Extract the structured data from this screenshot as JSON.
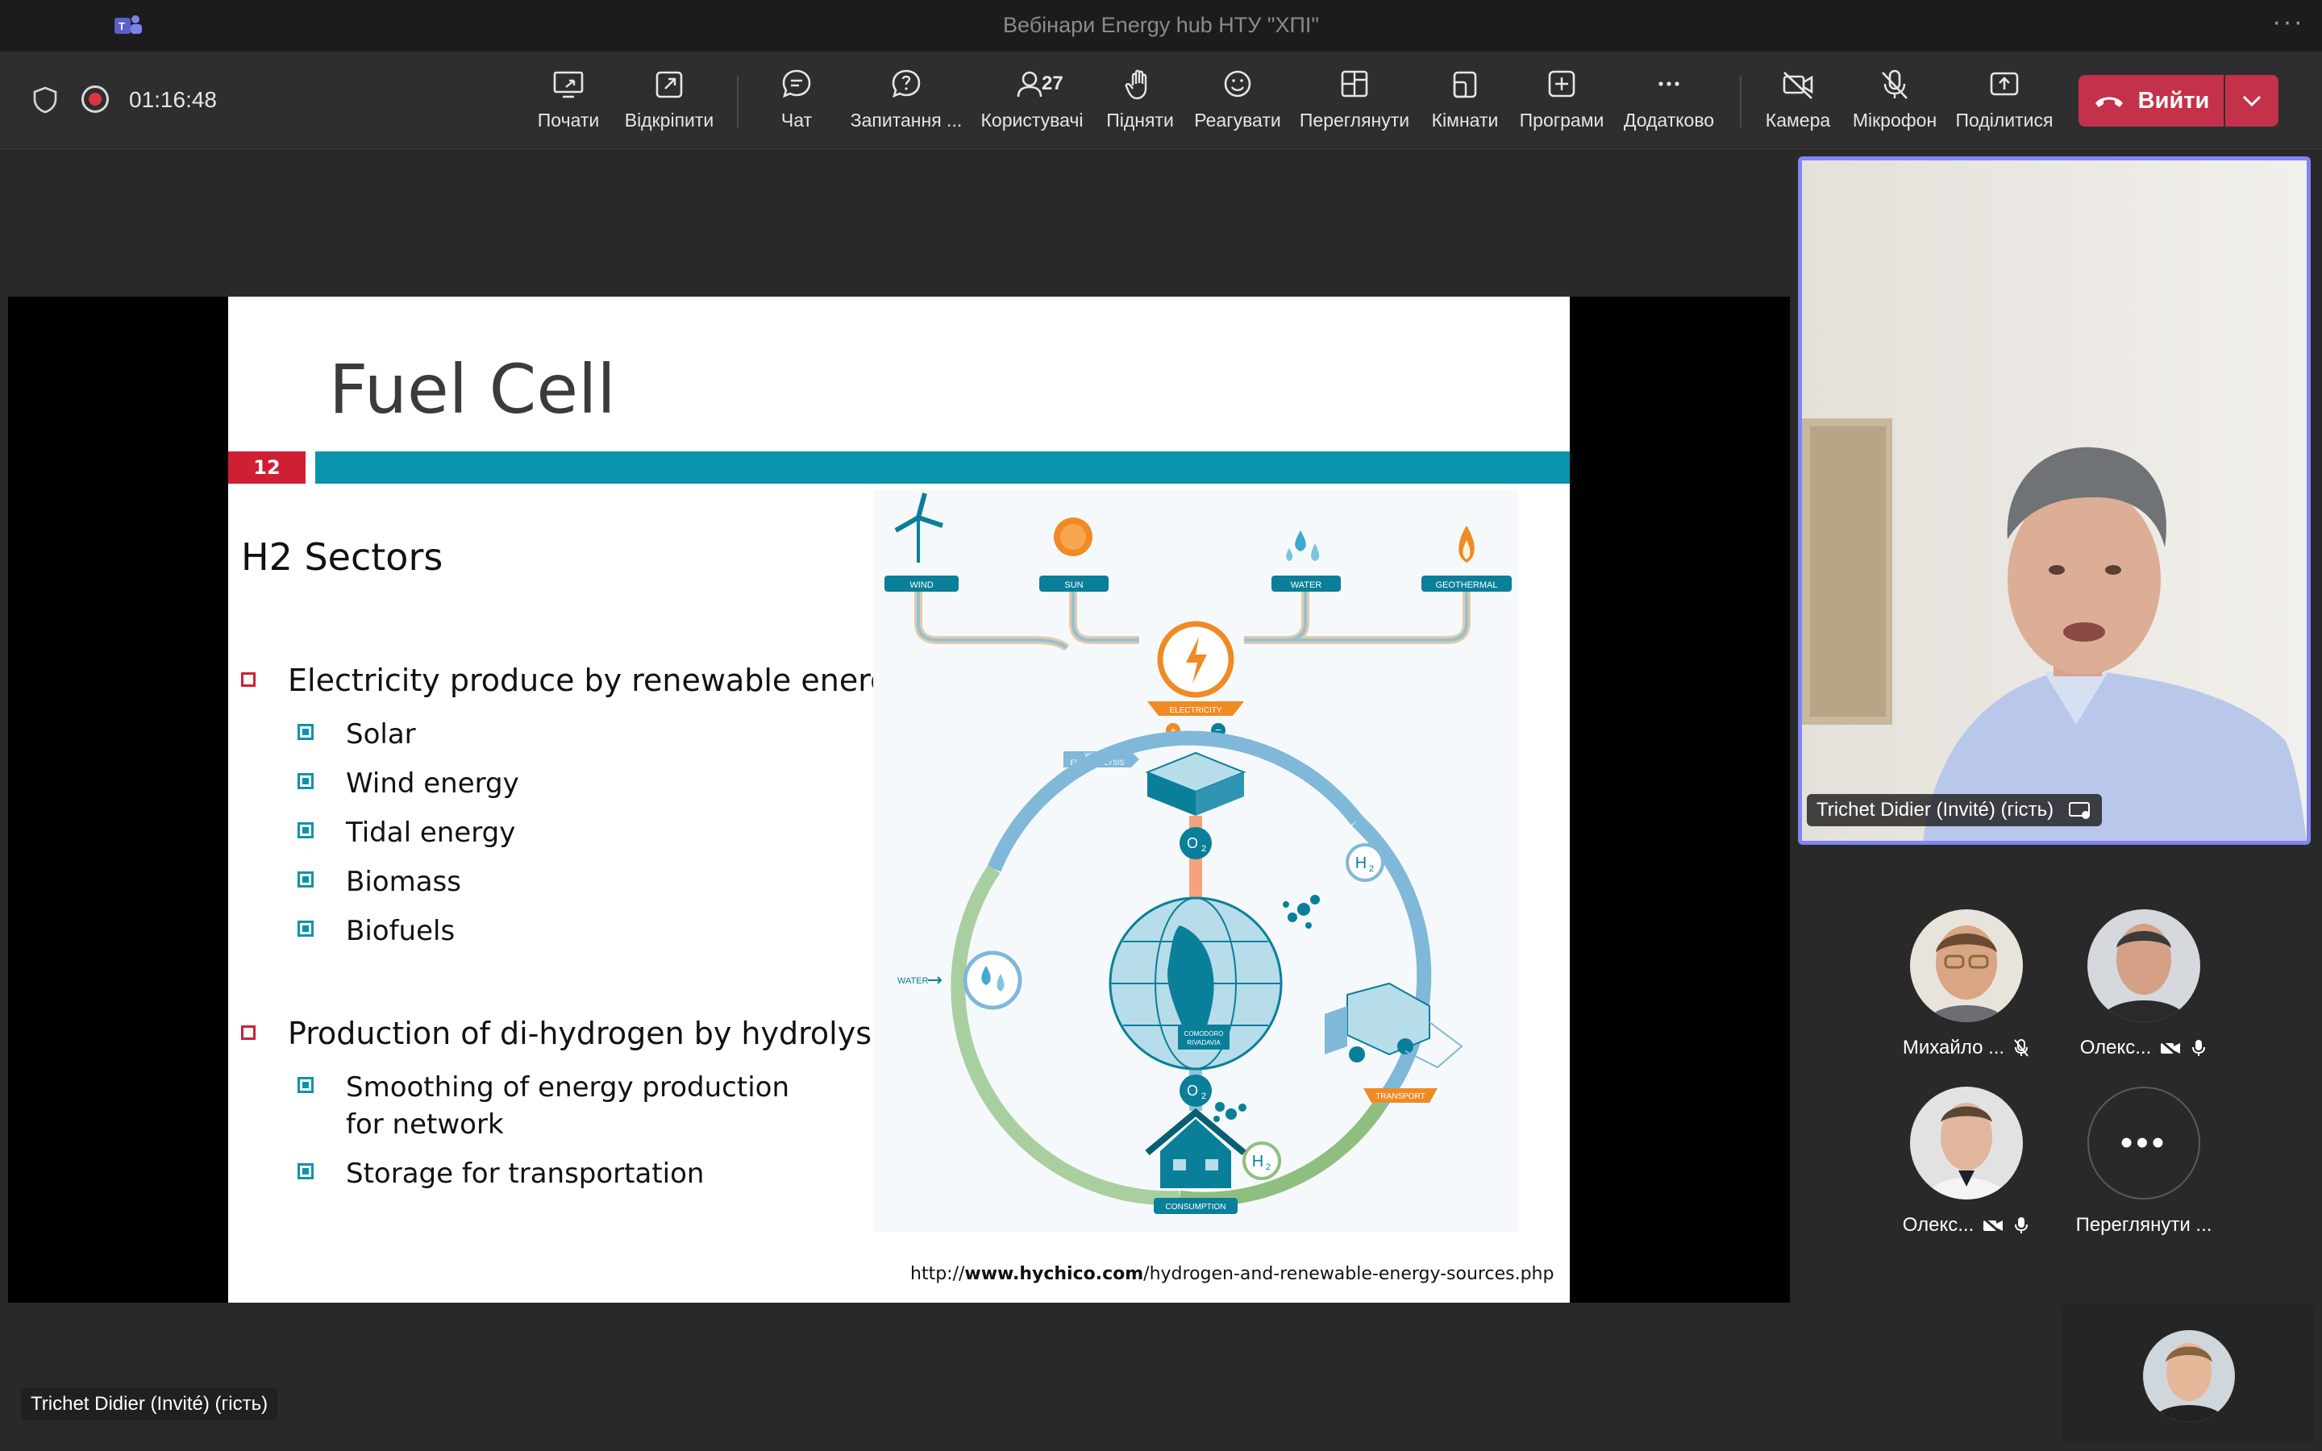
{
  "window": {
    "title": "Вебінари Energy hub НТУ \"ХПІ\"",
    "more": "···"
  },
  "toolbar": {
    "timer": "01:16:48",
    "buttons": {
      "present": "Почати",
      "popout": "Відкріпити",
      "chat": "Чат",
      "qa": "Запитання ...",
      "people": "Користувачі",
      "people_count": "27",
      "raise": "Підняти",
      "react": "Реагувати",
      "view": "Переглянути",
      "rooms": "Кімнати",
      "apps": "Програми",
      "more": "Додатково",
      "camera": "Камера",
      "mic": "Мікрофон",
      "share": "Поділитися"
    },
    "leave": "Вийти"
  },
  "slide": {
    "title": "Fuel Cell",
    "number": "12",
    "heading": "H2 Sectors",
    "bullet1": "Electricity produce by renewable energy",
    "sub1": [
      "Solar",
      "Wind energy",
      "Tidal energy",
      "Biomass",
      "Biofuels"
    ],
    "bullet2": "Production of di-hydrogen by hydrolyse",
    "sub2": [
      "Smoothing of energy production for network",
      "Storage for transportation"
    ],
    "source_prefix": "http://",
    "source_domain": "www.hychico.com",
    "source_path": "/hydrogen-and-renewable-energy-sources.php",
    "diagram": {
      "sources": [
        "WIND",
        "SUN",
        "WATER",
        "GEOTHERMAL"
      ],
      "electricity": "ELECTRICITY",
      "electrolysis": [
        "WATER",
        "ELECTROLYSIS"
      ],
      "water": "WATER",
      "transport": "TRANSPORT",
      "consumption": "CONSUMPTION",
      "o2": "O",
      "h2": "H",
      "sub2": "2",
      "globe": [
        "COMODORO",
        "RIVADAVIA"
      ],
      "colors": {
        "teal": "#0a7f9a",
        "orange": "#f08a24",
        "blue": "#7fb8d9",
        "green": "#8fbf7f"
      }
    }
  },
  "stage_presenter": "Trichet Didier (Invité) (гість)",
  "main_video": {
    "name": "Trichet Didier (Invité) (гість)"
  },
  "participants": [
    {
      "name": "Михайло ..."
    },
    {
      "name": "Олекс..."
    },
    {
      "name": "Олекс..."
    },
    {
      "name": "Переглянути ..."
    }
  ]
}
